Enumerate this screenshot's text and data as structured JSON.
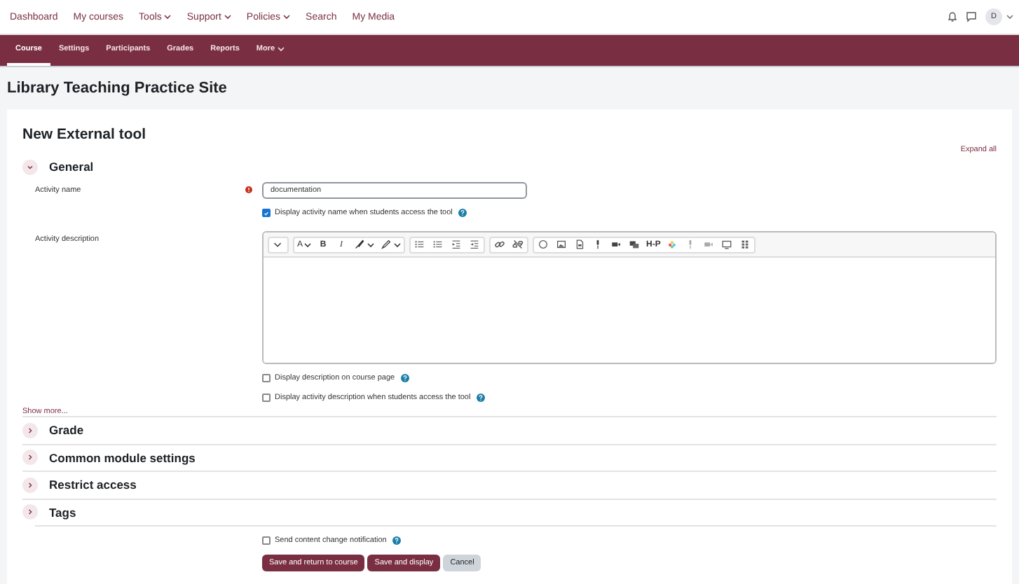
{
  "top_nav": {
    "items": [
      {
        "label": "Dashboard",
        "dropdown": false
      },
      {
        "label": "My courses",
        "dropdown": false
      },
      {
        "label": "Tools",
        "dropdown": true
      },
      {
        "label": "Support",
        "dropdown": true
      },
      {
        "label": "Policies",
        "dropdown": true
      },
      {
        "label": "Search",
        "dropdown": false
      },
      {
        "label": "My Media",
        "dropdown": false
      }
    ],
    "avatar_initial": "D"
  },
  "course_nav": [
    {
      "label": "Course",
      "selected": true,
      "dropdown": false
    },
    {
      "label": "Settings",
      "selected": false,
      "dropdown": false
    },
    {
      "label": "Participants",
      "selected": false,
      "dropdown": false
    },
    {
      "label": "Grades",
      "selected": false,
      "dropdown": false
    },
    {
      "label": "Reports",
      "selected": false,
      "dropdown": false
    },
    {
      "label": "More",
      "selected": false,
      "dropdown": true
    }
  ],
  "site_title": "Library Teaching Practice Site",
  "form": {
    "title": "New External tool",
    "expand_all": "Expand all",
    "general": {
      "title": "General",
      "expanded": true,
      "activity_name": {
        "label": "Activity name",
        "required": true,
        "value": "documentation"
      },
      "show_name": {
        "label": "Display activity name when students access the tool",
        "checked": true
      },
      "description": {
        "label": "Activity description",
        "toolbar": [
          [
            {
              "kind": "chevron"
            }
          ],
          [
            {
              "kind": "letter",
              "label": "A",
              "caret": true
            },
            {
              "kind": "bold",
              "label": "B"
            },
            {
              "kind": "italic",
              "label": "I"
            },
            {
              "kind": "brush",
              "caret": true
            },
            {
              "kind": "highlighter",
              "caret": true
            }
          ],
          [
            {
              "kind": "bullets"
            },
            {
              "kind": "numbers"
            },
            {
              "kind": "indent"
            },
            {
              "kind": "outdent"
            }
          ],
          [
            {
              "kind": "link"
            },
            {
              "kind": "unlink"
            }
          ],
          [
            {
              "kind": "emoji"
            },
            {
              "kind": "image"
            },
            {
              "kind": "file"
            },
            {
              "kind": "mic"
            },
            {
              "kind": "video"
            },
            {
              "kind": "media"
            },
            {
              "kind": "bold",
              "label": "H-P"
            },
            {
              "kind": "wheel"
            },
            {
              "kind": "mic",
              "muted": true
            },
            {
              "kind": "video",
              "muted": true
            },
            {
              "kind": "screen"
            },
            {
              "kind": "grid"
            }
          ]
        ]
      },
      "options": [
        {
          "label": "Display description on course page",
          "checked": false
        },
        {
          "label": "Display activity description when students access the tool",
          "checked": false
        }
      ],
      "show_more": "Show more..."
    },
    "sections": [
      {
        "title": "Grade",
        "expanded": false
      },
      {
        "title": "Common module settings",
        "expanded": false
      },
      {
        "title": "Restrict access",
        "expanded": false
      },
      {
        "title": "Tags",
        "expanded": false
      }
    ],
    "notification": {
      "label": "Send content change notification",
      "checked": false
    },
    "buttons": [
      {
        "label": "Save and return to course",
        "kind": "primary"
      },
      {
        "label": "Save and display",
        "kind": "primary"
      },
      {
        "label": "Cancel",
        "kind": "secondary"
      }
    ]
  }
}
